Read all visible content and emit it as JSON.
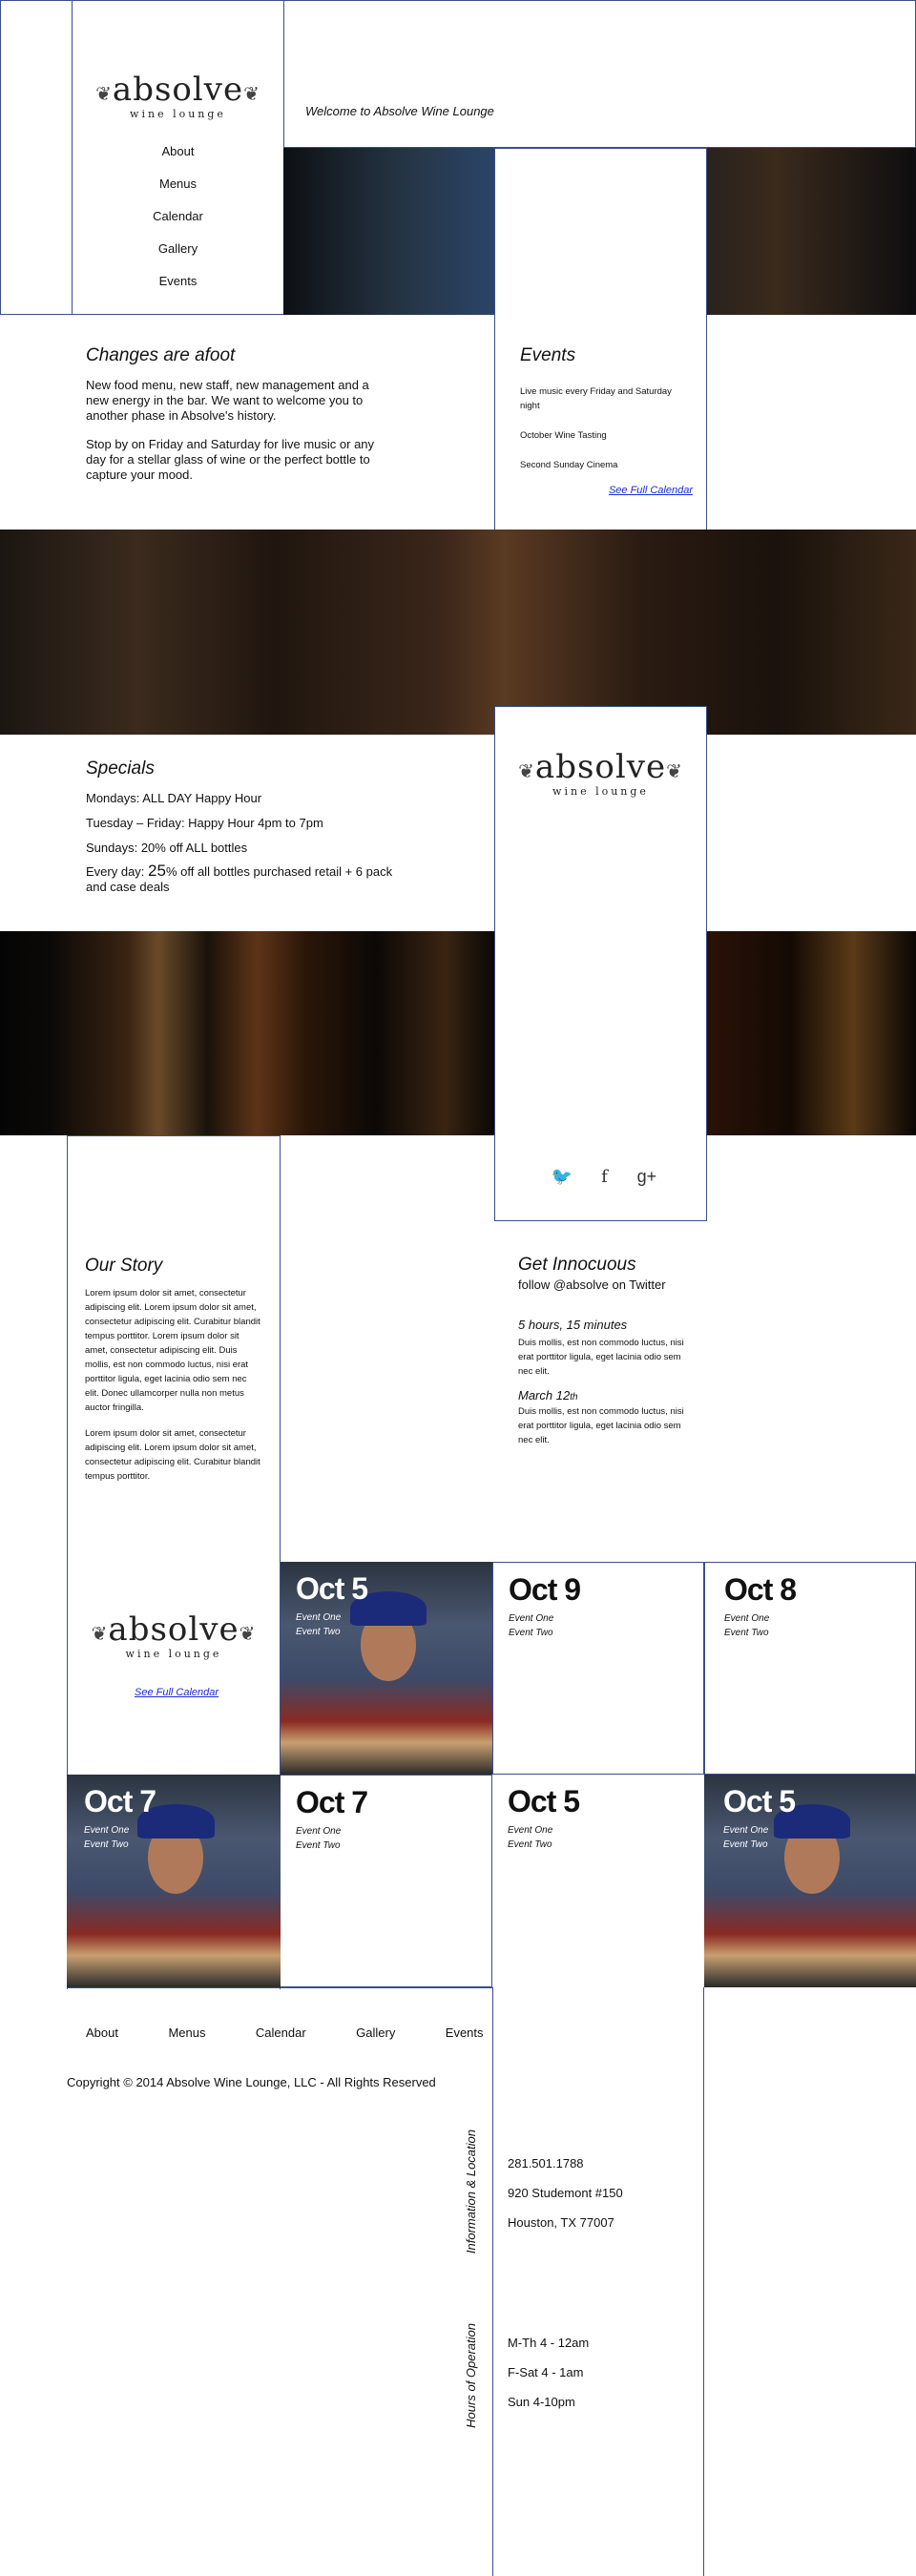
{
  "brand": {
    "word": "absolve",
    "sub": "wine lounge"
  },
  "header": {
    "welcome": "Welcome to Absolve Wine Lounge"
  },
  "nav": [
    "About",
    "Menus",
    "Calendar",
    "Gallery",
    "Events"
  ],
  "intro": {
    "title": "Changes are afoot",
    "p1": "New food menu, new staff, new management and a new energy in the bar. We want to welcome you to another phase in Absolve's history.",
    "p2": "Stop by on Friday and Saturday for live music or any day for a stellar glass of wine or the perfect bottle to capture your mood."
  },
  "events": {
    "title": "Events",
    "items": [
      "Live music every Friday and Saturday night",
      "October Wine Tasting",
      "Second Sunday Cinema"
    ],
    "link": "See Full Calendar"
  },
  "specials": {
    "title": "Specials",
    "lines": [
      "Mondays: ALL DAY Happy Hour",
      "Tuesday – Friday: Happy Hour 4pm to 7pm",
      "Sundays:  20% off ALL bottles"
    ],
    "everyday_prefix": "Every day: ",
    "everyday_big": "25",
    "everyday_rest": "% off all bottles purchased retail + 6 pack and case deals"
  },
  "social": {
    "twitter": "twitter-icon",
    "facebook": "f",
    "google": "g+"
  },
  "story": {
    "title": "Our Story",
    "p1": "Lorem ipsum dolor sit amet, consectetur adipiscing elit. Lorem ipsum dolor sit amet, consectetur adipiscing elit. Curabitur blandit tempus porttitor. Lorem ipsum dolor sit amet, consectetur adipiscing elit. Duis mollis, est non commodo luctus, nisi erat porttitor ligula, eget lacinia odio sem nec elit. Donec ullamcorper nulla non metus auctor fringilla.",
    "p2": "Lorem ipsum dolor sit amet, consectetur adipiscing elit. Lorem ipsum dolor sit amet, consectetur adipiscing elit. Curabitur blandit tempus porttitor."
  },
  "twitter": {
    "title": "Get Innocuous",
    "follow": "follow @absolve on Twitter",
    "t1_time": "5 hours, 15 minutes",
    "t1_text": "Duis mollis, est non commodo luctus, nisi erat porttitor ligula, eget lacinia odio sem nec elit.",
    "t2_time_a": "March 12",
    "t2_time_b": "th",
    "t2_text": "Duis mollis, est non commodo luctus, nisi erat porttitor ligula, eget lacinia odio sem nec elit."
  },
  "calendar_link": "See Full Calendar",
  "cards": [
    {
      "date": "Oct 5",
      "e1": "Event One",
      "e2": "Event Two"
    },
    {
      "date": "Oct 9",
      "e1": "Event One",
      "e2": "Event Two"
    },
    {
      "date": "Oct 8",
      "e1": "Event One",
      "e2": "Event Two"
    },
    {
      "date": "Oct 7",
      "e1": "Event One",
      "e2": "Event Two"
    },
    {
      "date": "Oct 7",
      "e1": "Event One",
      "e2": "Event Two"
    },
    {
      "date": "Oct 5",
      "e1": "Event One",
      "e2": "Event Two"
    },
    {
      "date": "Oct 5",
      "e1": "Event One",
      "e2": "Event Two"
    }
  ],
  "footer": {
    "copyright": "Copyright © 2014 Absolve Wine Lounge, LLC - All Rights Reserved",
    "info_label": "Information & Location",
    "hours_label": "Hours of Operation",
    "info": [
      "281.501.1788",
      "920 Studemont #150",
      "Houston, TX 77007"
    ],
    "hours": [
      "M-Th  4 - 12am",
      "F-Sat  4 - 1am",
      "Sun  4-10pm"
    ]
  }
}
